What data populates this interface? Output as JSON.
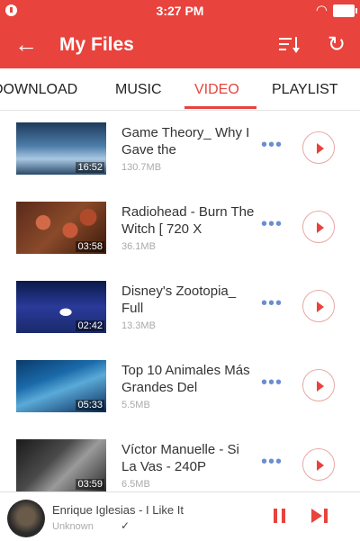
{
  "status_bar": {
    "time": "3:27 PM"
  },
  "app_bar": {
    "title": "My Files",
    "back_icon": "arrow-left-icon",
    "sort_icon": "sort-icon",
    "refresh_icon": "refresh-icon"
  },
  "tabs": [
    {
      "label": "DOWNLOAD",
      "selected": false
    },
    {
      "label": "MUSIC",
      "selected": false
    },
    {
      "label": "VIDEO",
      "selected": true
    },
    {
      "label": "PLAYLIST",
      "selected": false
    }
  ],
  "videos": [
    {
      "title": "Game Theory_ Why I Gave the",
      "size": "130.7MB",
      "duration": "16:52"
    },
    {
      "title": "Radiohead - Burn The Witch [ 720 X",
      "size": "36.1MB",
      "duration": "03:58"
    },
    {
      "title": "Disney's Zootopia_ Full",
      "size": "13.3MB",
      "duration": "02:42"
    },
    {
      "title": "Top 10 Animales Más Grandes Del",
      "size": "5.5MB",
      "duration": "05:33"
    },
    {
      "title": "Víctor Manuelle - Si La Vas - 240P",
      "size": "6.5MB",
      "duration": "03:59"
    }
  ],
  "player": {
    "title": "Enrique Iglesias - I Like It",
    "artist": "Unknown",
    "check": "✓"
  },
  "colors": {
    "accent": "#e8433d"
  }
}
